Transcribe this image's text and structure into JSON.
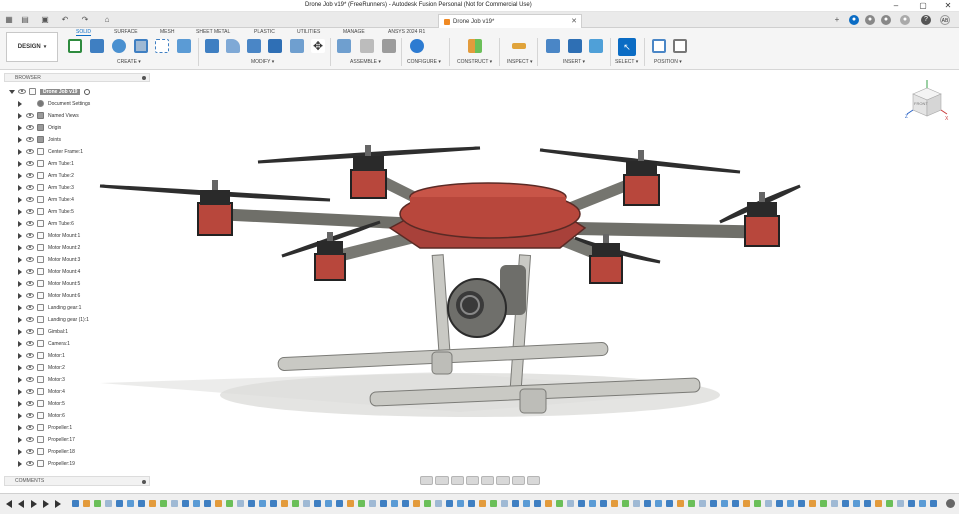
{
  "window": {
    "title": "Drone Job v19* (FreeRunners) - Autodesk Fusion Personal (Not for Commercial Use)",
    "controls": [
      "–",
      "▢",
      "✕"
    ]
  },
  "tabbar": {
    "doc_tab_label": "Drone Job v19*",
    "user_initials": "AB"
  },
  "ribbon": {
    "workspace_button": "DESIGN",
    "tabs": [
      "SOLID",
      "SURFACE",
      "MESH",
      "SHEET METAL",
      "PLASTIC",
      "UTILITIES",
      "MANAGE",
      "ANSYS 2024 R1"
    ],
    "groups": [
      "CREATE ▾",
      "MODIFY ▾",
      "ASSEMBLE ▾",
      "CONFIGURE ▾",
      "CONSTRUCT ▾",
      "INSPECT ▾",
      "INSERT ▾",
      "SELECT ▾",
      "POSITION ▾"
    ]
  },
  "browser": {
    "header": "BROWSER",
    "root": "Drone Job v19",
    "items": [
      {
        "label": "Document Settings",
        "icon": "gear-icon"
      },
      {
        "label": "Named Views",
        "icon": "folder-icon"
      },
      {
        "label": "Origin",
        "icon": "folder-icon"
      },
      {
        "label": "Joints",
        "icon": "folder-icon"
      },
      {
        "label": "Center Frame:1",
        "icon": "component-icon"
      },
      {
        "label": "Arm Tube:1",
        "icon": "component-icon"
      },
      {
        "label": "Arm Tube:2",
        "icon": "component-icon"
      },
      {
        "label": "Arm Tube:3",
        "icon": "component-icon"
      },
      {
        "label": "Arm Tube:4",
        "icon": "component-icon"
      },
      {
        "label": "Arm Tube:5",
        "icon": "component-icon"
      },
      {
        "label": "Arm Tube:6",
        "icon": "component-icon"
      },
      {
        "label": "Motor Mount:1",
        "icon": "component-icon"
      },
      {
        "label": "Motor Mount:2",
        "icon": "component-icon"
      },
      {
        "label": "Motor Mount:3",
        "icon": "component-icon"
      },
      {
        "label": "Motor Mount:4",
        "icon": "component-icon"
      },
      {
        "label": "Motor Mount:5",
        "icon": "component-icon"
      },
      {
        "label": "Motor Mount:6",
        "icon": "component-icon"
      },
      {
        "label": "Landing gear:1",
        "icon": "component-icon"
      },
      {
        "label": "Landing gear (1):1",
        "icon": "component-icon"
      },
      {
        "label": "Gimbal:1",
        "icon": "component-icon"
      },
      {
        "label": "Camera:1",
        "icon": "component-icon"
      },
      {
        "label": "Motor:1",
        "icon": "component-icon"
      },
      {
        "label": "Motor:2",
        "icon": "component-icon"
      },
      {
        "label": "Motor:3",
        "icon": "component-icon"
      },
      {
        "label": "Motor:4",
        "icon": "component-icon"
      },
      {
        "label": "Motor:5",
        "icon": "component-icon"
      },
      {
        "label": "Motor:6",
        "icon": "component-icon"
      },
      {
        "label": "Propeller:1",
        "icon": "component-icon"
      },
      {
        "label": "Propeller:17",
        "icon": "component-icon"
      },
      {
        "label": "Propeller:18",
        "icon": "component-icon"
      },
      {
        "label": "Propeller:19",
        "icon": "component-icon"
      }
    ]
  },
  "comments": {
    "header": "COMMENTS"
  },
  "viewcube": {
    "face_label": "FRONT",
    "axis_z": "Z",
    "axis_x": "X"
  },
  "colors": {
    "accent": "#0b6cc4",
    "frame_red": "#b8473c",
    "tube_gray": "#7a7a74",
    "leg_light": "#c9c9c4"
  }
}
